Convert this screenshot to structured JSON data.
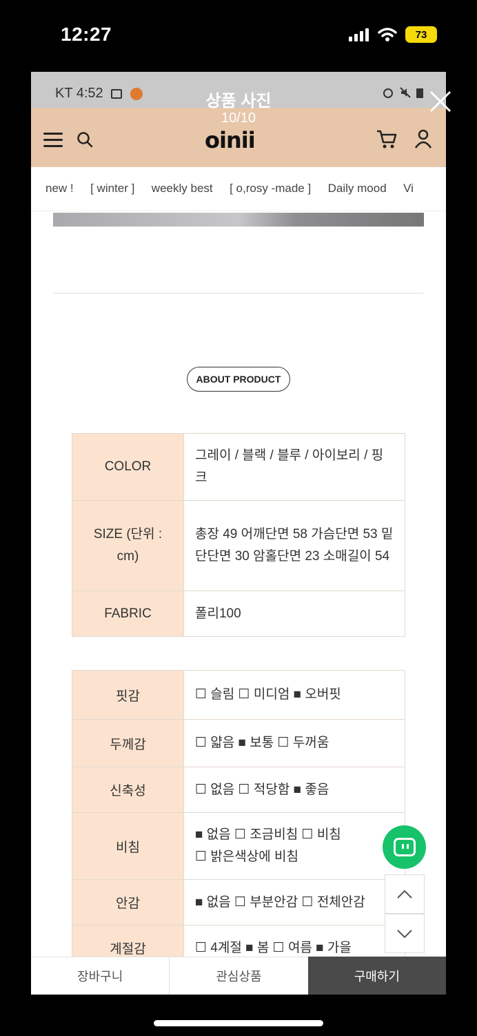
{
  "ios": {
    "time": "12:27",
    "battery": "73"
  },
  "viewer": {
    "title": "상품 사진",
    "counter": "10/10"
  },
  "android": {
    "time": "KT 4:52"
  },
  "header": {
    "logo": "oinii"
  },
  "nav": [
    "new !",
    "[ winter ]",
    "weekly best",
    "[ o,rosy -made ]",
    "Daily mood",
    "Vi"
  ],
  "about_label": "ABOUT PRODUCT",
  "spec_rows": [
    {
      "key": "COLOR",
      "value": "그레이 / 블랙 / 블루 / 아이보리 / 핑크"
    },
    {
      "key": "SIZE (단위 : cm)",
      "value": "총장 49 어깨단면 58 가슴단면 53 밑단단면 30 암홀단면 23 소매길이 54"
    },
    {
      "key": "FABRIC",
      "value": "폴리100"
    }
  ],
  "feature_rows": [
    {
      "key": "핏감",
      "value": "☐ 슬림   ☐ 미디엄   ■ 오버핏"
    },
    {
      "key": "두께감",
      "value": "☐ 얇음   ■ 보통   ☐ 두꺼움"
    },
    {
      "key": "신축성",
      "value": "☐ 없음   ☐ 적당함   ■ 좋음"
    },
    {
      "key": "비침",
      "value": "■ 없음   ☐ 조금비침   ☐ 비침   ☐ 밝은색상에 비침"
    },
    {
      "key": "안감",
      "value": "■ 없음   ☐ 부분안감   ☐ 전체안감"
    },
    {
      "key": "계절감",
      "value": "☐ 4계절   ■ 봄   ☐ 여름   ■ 가을"
    }
  ],
  "bottom": {
    "cart": "장바구니",
    "wish": "관심상품",
    "buy": "구매하기"
  },
  "colors": {
    "header_bg": "#e7c6a9",
    "table_key_bg": "#fbe3cf",
    "chat_green": "#16c36a",
    "battery": "#f5d90a"
  }
}
